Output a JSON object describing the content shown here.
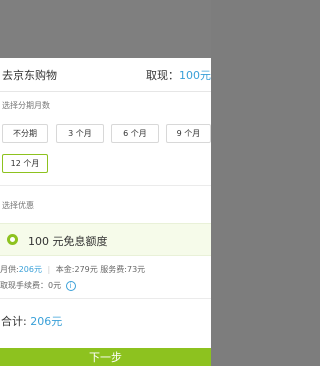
{
  "header": {
    "title": "去京东购物",
    "withdraw_label": "取现：",
    "withdraw_amount": "100元"
  },
  "installments": {
    "label": "选择分期月数",
    "options": [
      "不分期",
      "3 个月",
      "6 个月",
      "9 个月",
      "12 个月"
    ],
    "selected": "12 个月"
  },
  "coupon": {
    "label": "选择优惠",
    "option": "100 元免息额度"
  },
  "summary": {
    "monthly_label": "月供:",
    "monthly_value": "206元",
    "principal": "本金:279元",
    "service_fee": "服务费:73元",
    "withdraw_fee": "取现手续费：0元"
  },
  "total": {
    "label": "合计:",
    "value": "206元"
  },
  "footer": {
    "next_label": "下一步"
  },
  "colors": {
    "accent_green": "#8dc21f",
    "price_blue": "#3aa0d8",
    "overlay": "#7f7f7f"
  }
}
